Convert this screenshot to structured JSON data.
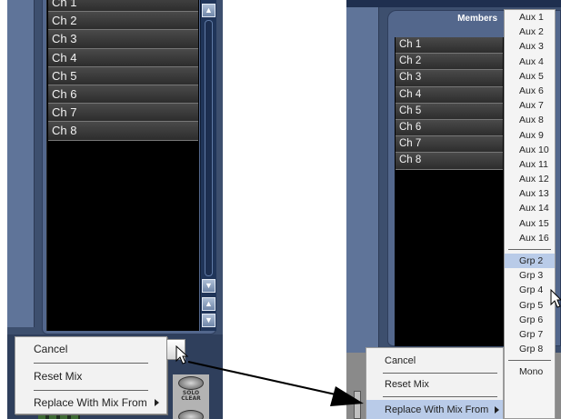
{
  "left_panel": {
    "channels": [
      "Ch 1",
      "Ch 2",
      "Ch 3",
      "Ch 4",
      "Ch 5",
      "Ch 6",
      "Ch 7",
      "Ch 8"
    ],
    "context_menu": {
      "cancel": "Cancel",
      "reset_mix": "Reset Mix",
      "replace_with_mix_from": "Replace With Mix From"
    },
    "hardware": {
      "solo_clear_line1": "SOLO",
      "solo_clear_line2": "CLEAR"
    }
  },
  "right_panel": {
    "members_tab": "Members",
    "channels": [
      "Ch 1",
      "Ch 2",
      "Ch 3",
      "Ch 4",
      "Ch 5",
      "Ch 6",
      "Ch 7",
      "Ch 8"
    ],
    "context_menu": {
      "cancel": "Cancel",
      "reset_mix": "Reset Mix",
      "replace_with_mix_from": "Replace With Mix From"
    },
    "submenu": {
      "aux": [
        "Aux 1",
        "Aux 2",
        "Aux 3",
        "Aux 4",
        "Aux 5",
        "Aux 6",
        "Aux 7",
        "Aux 8",
        "Aux 9",
        "Aux 10",
        "Aux 11",
        "Aux 12",
        "Aux 13",
        "Aux 14",
        "Aux 15",
        "Aux 16"
      ],
      "groups": [
        "Grp 2",
        "Grp 3",
        "Grp 4",
        "Grp 5",
        "Grp 6",
        "Grp 7",
        "Grp 8"
      ],
      "mono": "Mono",
      "highlighted": "Grp 2"
    }
  },
  "colors": {
    "panel_bg": "#3d4f6e",
    "highlight": "#b9cbe8",
    "menu_bg": "#f2f2f2"
  }
}
